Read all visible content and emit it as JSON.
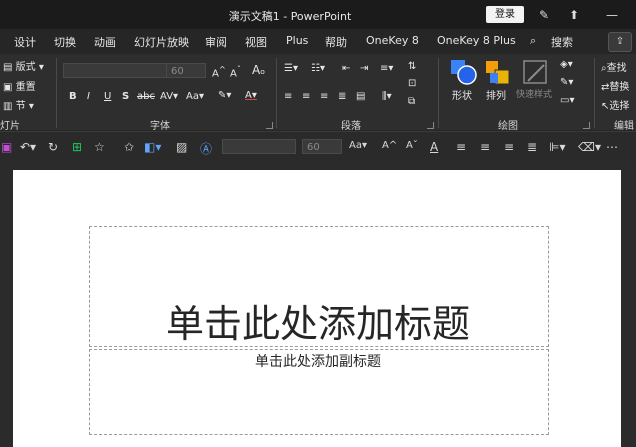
{
  "window": {
    "doc_title": "演示文稿1  -  PowerPoint",
    "login": "登录"
  },
  "ribbon_tabs": [
    {
      "label": "设计"
    },
    {
      "label": "切换"
    },
    {
      "label": "动画"
    },
    {
      "label": "幻灯片放映"
    },
    {
      "label": "审阅"
    },
    {
      "label": "视图"
    },
    {
      "label": "Plus"
    },
    {
      "label": "帮助"
    },
    {
      "label": "OneKey 8"
    },
    {
      "label": "OneKey 8 Plus"
    },
    {
      "label": "搜索"
    }
  ],
  "slides_group": {
    "layout": "版式",
    "reset": "重置",
    "section": "节",
    "label": "灯片"
  },
  "font_group": {
    "size": "60",
    "bold": "B",
    "italic": "I",
    "underline": "U",
    "shadow": "S",
    "strike": "abc",
    "label": "字体"
  },
  "paragraph_group": {
    "label": "段落"
  },
  "drawing_group": {
    "shapes": "形状",
    "arrange": "排列",
    "quick_styles": "快速样式",
    "label": "绘图"
  },
  "editing_group": {
    "find": "查找",
    "replace": "替换",
    "select": "选择",
    "label": "编辑"
  },
  "qat": {
    "size": "60"
  },
  "slide": {
    "title_placeholder": "单击此处添加标题",
    "subtitle_placeholder": "单击此处添加副标题"
  },
  "colors": {
    "background": "#262626",
    "titlebar": "#1b1b1b",
    "ribbon": "#2e2e2e",
    "slide": "#ffffff"
  }
}
